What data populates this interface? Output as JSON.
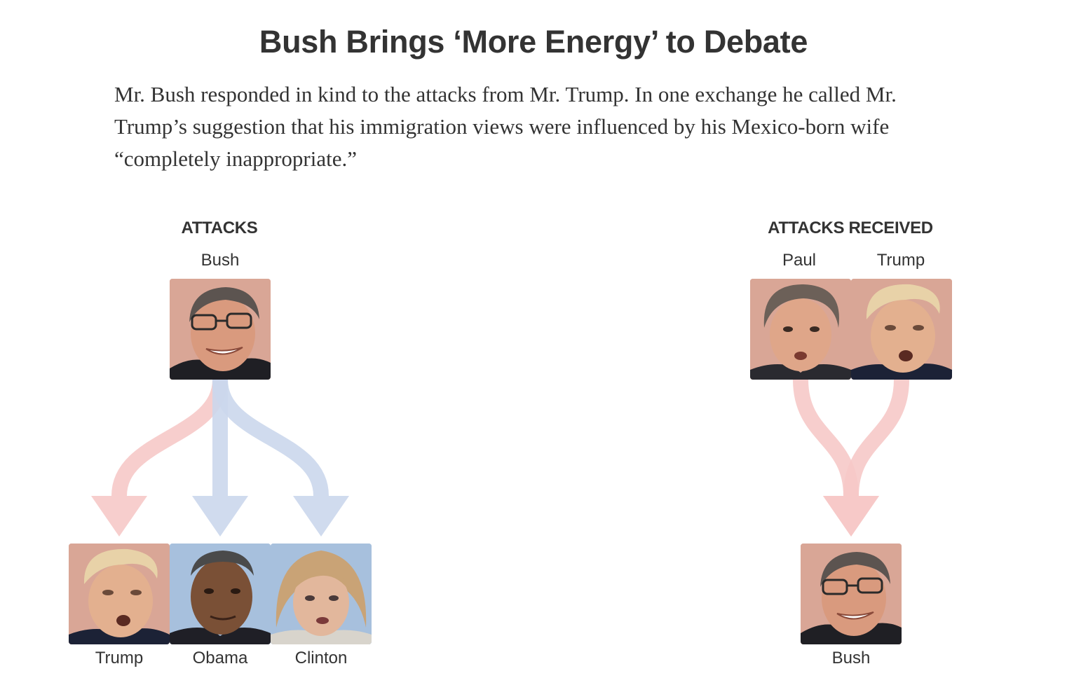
{
  "headline": "Bush Brings ‘More Energy’ to Debate",
  "deck": "Mr. Bush responded in kind to the attacks from Mr. Trump. In one exchange he called Mr. Trump’s suggestion that his immigration views were influenced by his Mexico-born wife “completely inappropriate.”",
  "colors": {
    "attack_from_republican": "#f6c9c8",
    "attack_from_democrat": "#cbd7ec",
    "portrait_bg_republican": "#dba99b",
    "portrait_bg_democrat": "#9ab7d9"
  },
  "attacks": {
    "title": "ATTACKS",
    "source": "Bush",
    "targets": [
      {
        "name": "Trump",
        "party": "republican"
      },
      {
        "name": "Obama",
        "party": "democrat"
      },
      {
        "name": "Clinton",
        "party": "democrat"
      }
    ]
  },
  "attacks_received": {
    "title": "ATTACKS RECEIVED",
    "sources": [
      {
        "name": "Paul",
        "party": "republican"
      },
      {
        "name": "Trump",
        "party": "republican"
      }
    ],
    "target": "Bush"
  }
}
